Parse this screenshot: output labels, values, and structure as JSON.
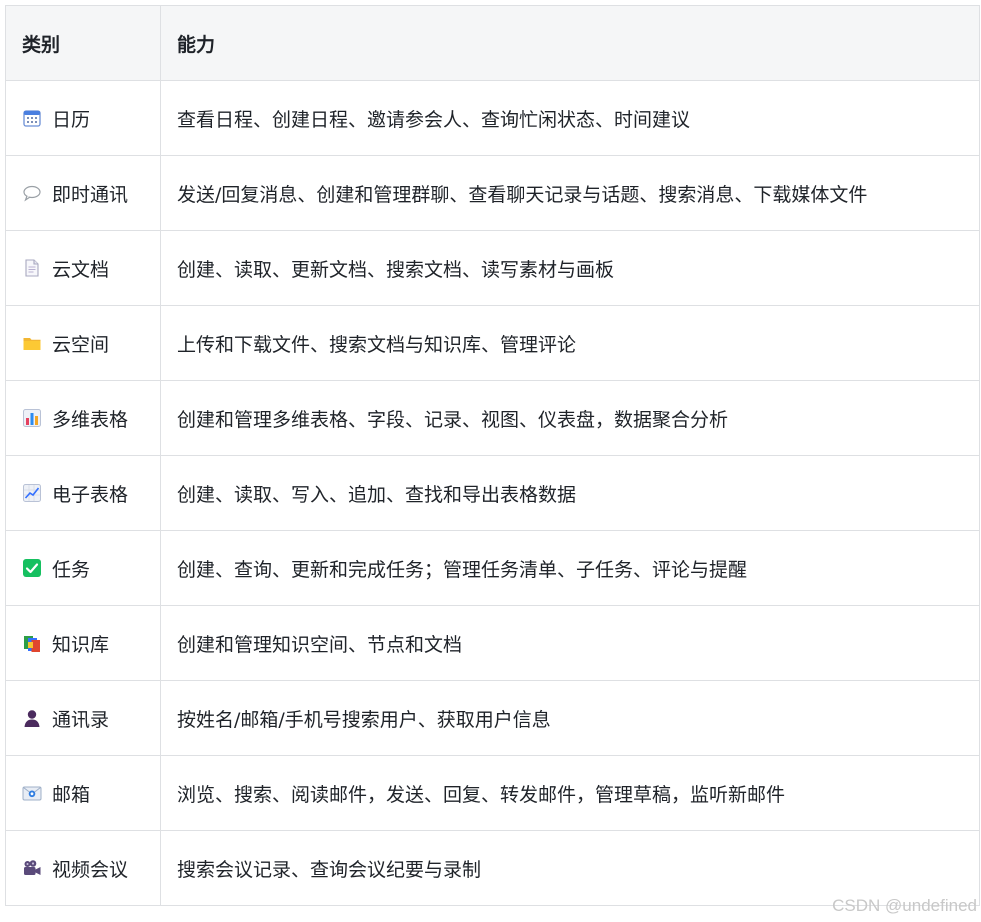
{
  "table": {
    "headers": [
      "类别",
      "能力"
    ],
    "rows": [
      {
        "icon": "calendar-icon",
        "category": "日历",
        "capability": "查看日程、创建日程、邀请参会人、查询忙闲状态、时间建议"
      },
      {
        "icon": "speech-bubble-icon",
        "category": "即时通讯",
        "capability": "发送/回复消息、创建和管理群聊、查看聊天记录与话题、搜索消息、下载媒体文件"
      },
      {
        "icon": "document-icon",
        "category": "云文档",
        "capability": "创建、读取、更新文档、搜索文档、读写素材与画板"
      },
      {
        "icon": "folder-icon",
        "category": "云空间",
        "capability": "上传和下载文件、搜索文档与知识库、管理评论"
      },
      {
        "icon": "bar-chart-icon",
        "category": "多维表格",
        "capability": "创建和管理多维表格、字段、记录、视图、仪表盘，数据聚合分析"
      },
      {
        "icon": "line-chart-icon",
        "category": "电子表格",
        "capability": "创建、读取、写入、追加、查找和导出表格数据"
      },
      {
        "icon": "check-box-icon",
        "category": "任务",
        "capability": "创建、查询、更新和完成任务；管理任务清单、子任务、评论与提醒"
      },
      {
        "icon": "books-icon",
        "category": "知识库",
        "capability": "创建和管理知识空间、节点和文档"
      },
      {
        "icon": "person-icon",
        "category": "通讯录",
        "capability": "按姓名/邮箱/手机号搜索用户、获取用户信息"
      },
      {
        "icon": "envelope-icon",
        "category": "邮箱",
        "capability": "浏览、搜索、阅读邮件，发送、回复、转发邮件，管理草稿，监听新邮件"
      },
      {
        "icon": "movie-camera-icon",
        "category": "视频会议",
        "capability": "搜索会议记录、查询会议纪要与录制"
      }
    ]
  },
  "watermark": "CSDN @undefined"
}
